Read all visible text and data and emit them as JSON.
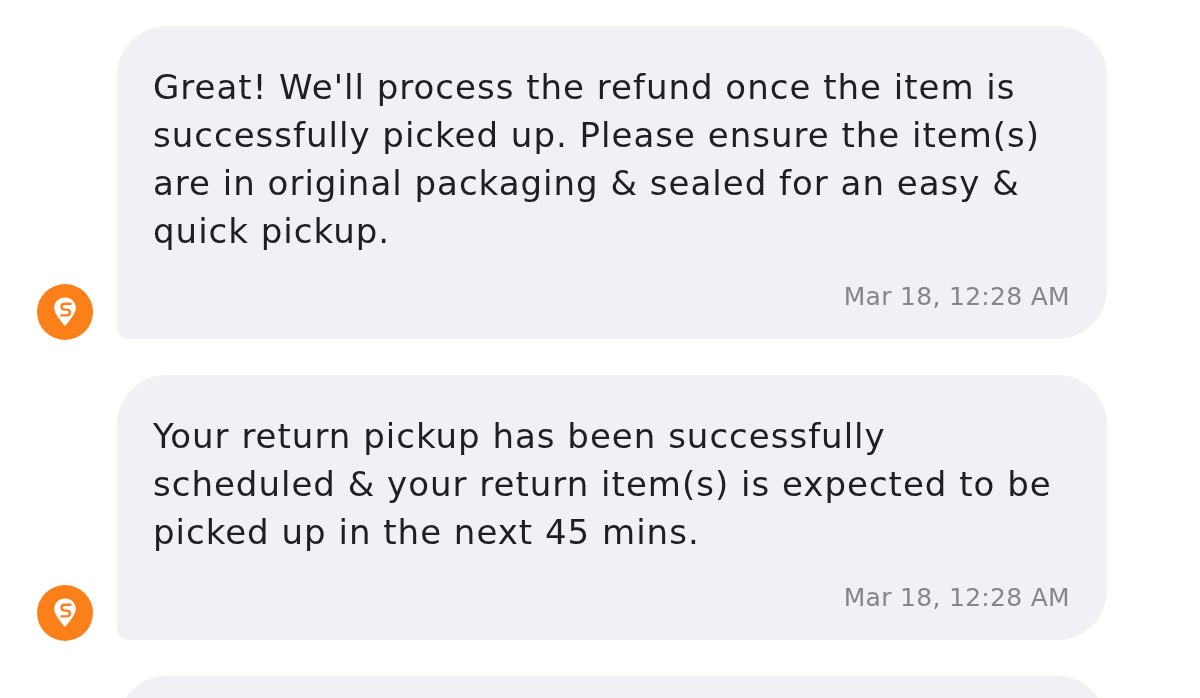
{
  "messages": [
    {
      "kind": "text",
      "text": "Great! We'll process the refund once the item is successfully picked up. Please ensure the item(s) are in original packaging & sealed for an easy & quick pickup.",
      "time": "Mar 18, 12:28 AM"
    },
    {
      "kind": "text",
      "text": "Your return pickup has been successfully scheduled & your return item(s) is expected to be picked up in the next 45 mins.",
      "time": "Mar 18, 12:28 AM"
    },
    {
      "kind": "partial"
    }
  ]
}
